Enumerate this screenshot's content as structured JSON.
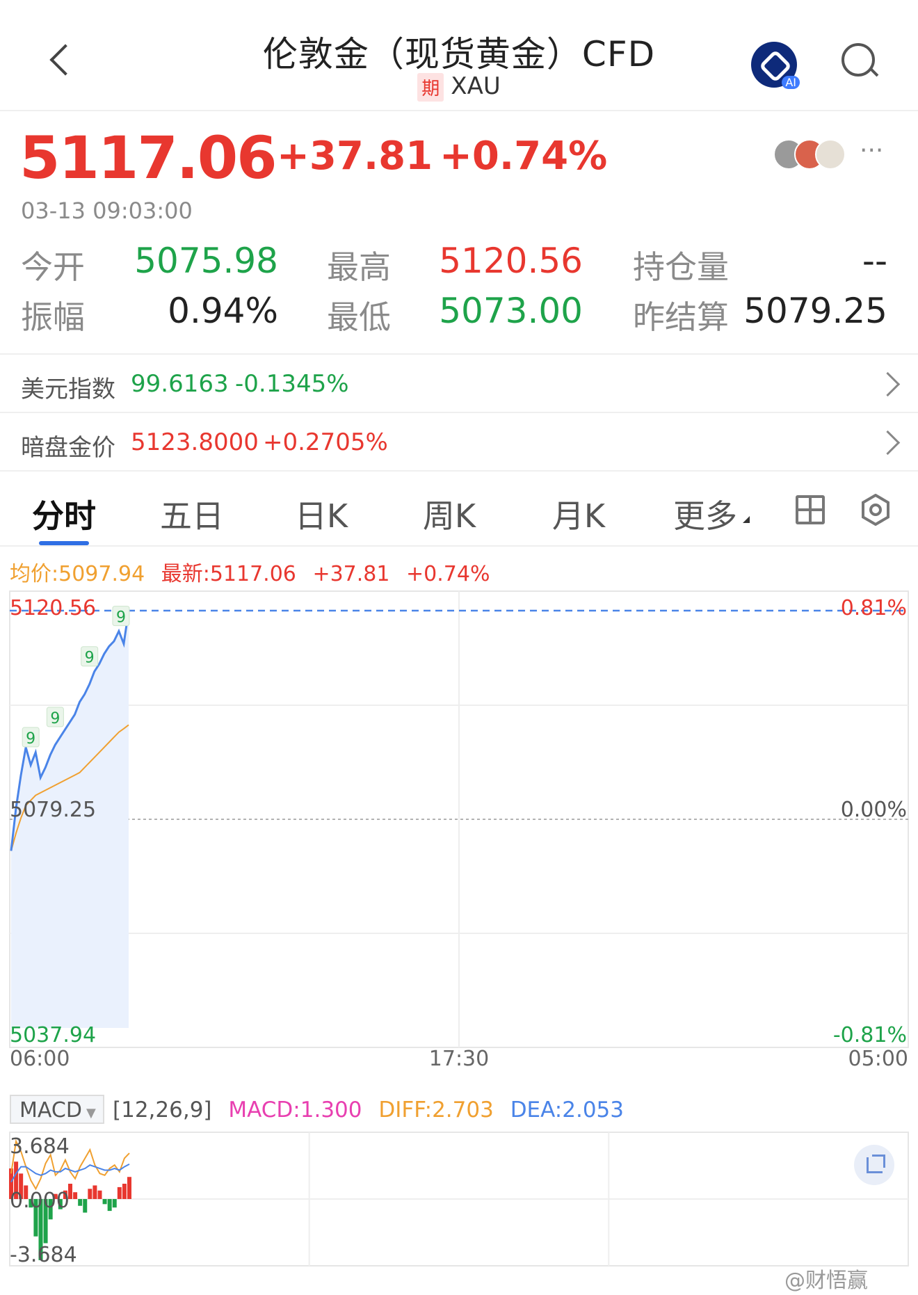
{
  "header": {
    "title": "伦敦金（现货黄金）CFD",
    "tag": "期",
    "symbol": "XAU",
    "back_icon": "chevron-left-icon",
    "ai_label": "AI",
    "search_icon": "search-icon"
  },
  "quote": {
    "price": "5117.06",
    "change": "+37.81",
    "change_pct": "+0.74%",
    "time": "03-13 09:03:00",
    "more": "···"
  },
  "stats": [
    {
      "label": "今开",
      "value": "5075.98",
      "color": "green"
    },
    {
      "label": "最高",
      "value": "5120.56",
      "color": "red"
    },
    {
      "label": "持仓量",
      "value": "--",
      "color": "dark"
    },
    {
      "label": "振幅",
      "value": "0.94%",
      "color": "dark"
    },
    {
      "label": "最低",
      "value": "5073.00",
      "color": "green"
    },
    {
      "label": "昨结算",
      "value": "5079.25",
      "color": "dark"
    }
  ],
  "related": [
    {
      "label": "美元指数",
      "value": "99.6163",
      "pct": "-0.1345%",
      "color": "green"
    },
    {
      "label": "暗盘金价",
      "value": "5123.8000",
      "pct": "+0.2705%",
      "color": "red"
    }
  ],
  "tabs": [
    "分时",
    "五日",
    "日K",
    "周K",
    "月K",
    "更多"
  ],
  "legend": {
    "avg": "均价:5097.94",
    "latest": "最新:5117.06",
    "chg": "+37.81",
    "pct": "+0.74%"
  },
  "colors": {
    "up": "#e8372f",
    "down": "#1ea34a",
    "price_line": "#4a84e8",
    "avg_line": "#f0a030",
    "macd": "#e83fb0",
    "diff": "#f0a030",
    "dea": "#4a84e8"
  },
  "chart_data": {
    "type": "line",
    "y_left_labels": [
      "5120.56",
      "5079.25",
      "5037.94"
    ],
    "y_right_labels": [
      "0.81%",
      "0.00%",
      "-0.81%"
    ],
    "x_labels": [
      "06:00",
      "17:30",
      "05:00"
    ],
    "ylim": [
      5037.94,
      5120.56
    ],
    "reference": 5079.25,
    "markers": [
      "9",
      "9",
      "9",
      "9"
    ],
    "series": [
      {
        "name": "最新",
        "values": [
          5073.0,
          5081.5,
          5088.0,
          5093.5,
          5090.0,
          5092.5,
          5087.5,
          5089.5,
          5092.0,
          5094.0,
          5095.5,
          5097.0,
          5098.5,
          5100.0,
          5102.5,
          5104.0,
          5106.0,
          5108.5,
          5110.0,
          5112.0,
          5113.5,
          5114.5,
          5116.5,
          5114.0,
          5120.56
        ]
      },
      {
        "name": "均价",
        "values": [
          5073.0,
          5076.5,
          5079.5,
          5082.0,
          5083.0,
          5084.0,
          5084.5,
          5085.0,
          5085.5,
          5086.0,
          5086.5,
          5087.0,
          5087.5,
          5088.0,
          5088.5,
          5089.5,
          5090.5,
          5091.5,
          5092.5,
          5093.5,
          5094.5,
          5095.5,
          5096.5,
          5097.2,
          5097.94
        ]
      }
    ]
  },
  "macd": {
    "selector": "MACD",
    "params": "[12,26,9]",
    "macd": "MACD:1.300",
    "diff": "DIFF:2.703",
    "dea": "DEA:2.053",
    "ymax": "3.684",
    "ymid": "0.000",
    "ymin": "-3.684",
    "bars": [
      1.8,
      2.2,
      1.5,
      0.8,
      -0.5,
      -2.2,
      -3.6,
      -2.6,
      -1.2,
      0.3,
      -0.6,
      0.5,
      0.9,
      0.4,
      -0.4,
      -0.8,
      0.6,
      0.8,
      0.5,
      -0.3,
      -0.7,
      -0.5,
      0.7,
      0.9,
      1.3
    ],
    "diff_line": [
      1.5,
      3.4,
      2.8,
      1.9,
      1.1,
      0.6,
      1.2,
      2.1,
      2.6,
      1.4,
      1.7,
      2.3,
      1.6,
      1.2,
      1.9,
      2.4,
      2.9,
      2.0,
      1.5,
      1.4,
      1.8,
      2.0,
      1.6,
      2.4,
      2.7
    ],
    "dea_line": [
      1.0,
      1.5,
      1.9,
      1.9,
      1.7,
      1.5,
      1.4,
      1.5,
      1.7,
      1.6,
      1.6,
      1.8,
      1.7,
      1.6,
      1.7,
      1.8,
      2.0,
      1.9,
      1.8,
      1.7,
      1.7,
      1.8,
      1.7,
      1.9,
      2.05
    ]
  },
  "watermark": "@财悟赢"
}
